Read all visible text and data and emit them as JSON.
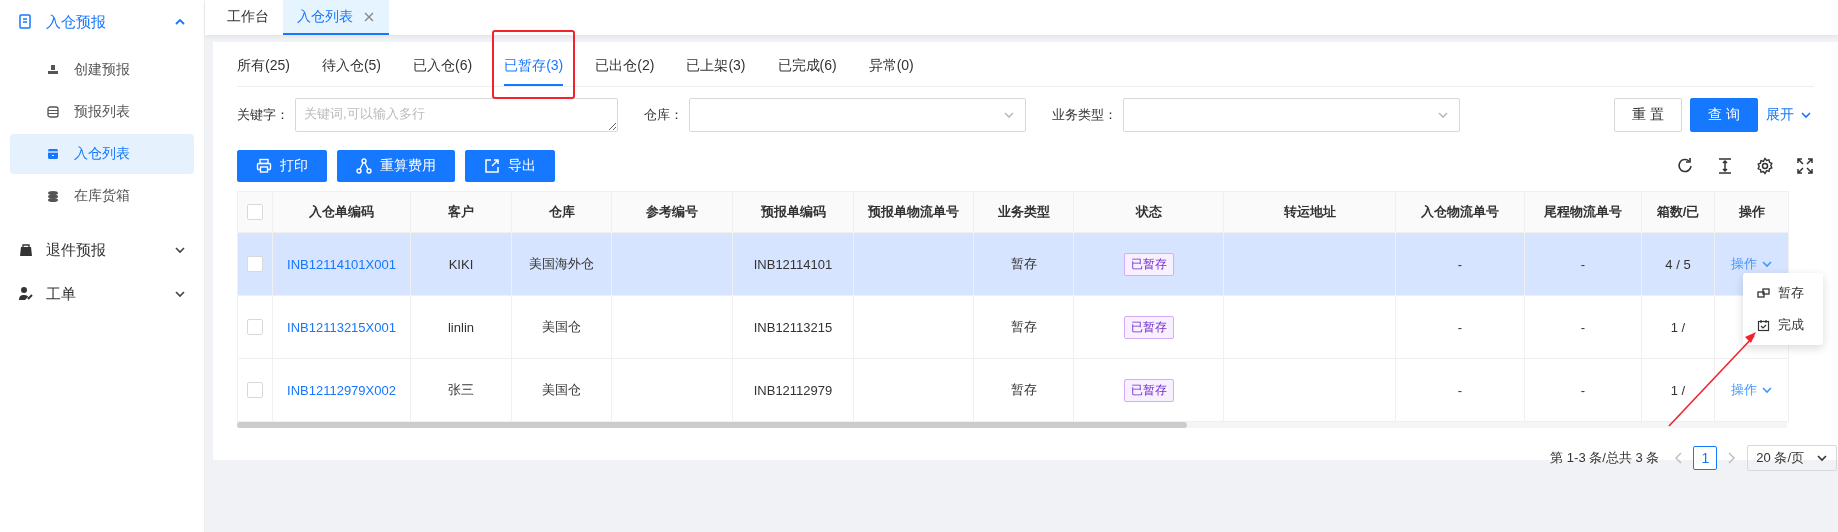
{
  "sidebar": {
    "items": [
      {
        "label": "入仓预报",
        "selected": true,
        "expanded": true,
        "children": [
          {
            "label": "创建预报",
            "selected": false
          },
          {
            "label": "预报列表",
            "selected": false
          },
          {
            "label": "入仓列表",
            "selected": true
          },
          {
            "label": "在库货箱",
            "selected": false
          }
        ]
      },
      {
        "label": "退件预报",
        "selected": false,
        "expanded": false
      },
      {
        "label": "工单",
        "selected": false,
        "expanded": false
      }
    ]
  },
  "page_tabs": [
    {
      "label": "工作台",
      "selected": false,
      "closable": false
    },
    {
      "label": "入仓列表",
      "selected": true,
      "closable": true
    }
  ],
  "status_tabs": [
    {
      "label": "所有(25)",
      "selected": false,
      "marked": false
    },
    {
      "label": "待入仓(5)",
      "selected": false,
      "marked": false
    },
    {
      "label": "已入仓(6)",
      "selected": false,
      "marked": false
    },
    {
      "label": "已暂存(3)",
      "selected": true,
      "marked": true
    },
    {
      "label": "已出仓(2)",
      "selected": false,
      "marked": false
    },
    {
      "label": "已上架(3)",
      "selected": false,
      "marked": false
    },
    {
      "label": "已完成(6)",
      "selected": false,
      "marked": false
    },
    {
      "label": "异常(0)",
      "selected": false,
      "marked": false
    }
  ],
  "filters": [
    {
      "kind": "textarea",
      "label": "关键字：",
      "placeholder": "关键词,可以输入多行"
    },
    {
      "kind": "select",
      "label": "仓库："
    },
    {
      "kind": "select",
      "label": "业务类型："
    }
  ],
  "filter_actions": {
    "reset": "重 置",
    "query": "查 询",
    "expand": "展开"
  },
  "action_buttons": [
    {
      "label": "打印"
    },
    {
      "label": "重算费用"
    },
    {
      "label": "导出"
    }
  ],
  "table": {
    "all_checked": false,
    "columns": [
      "入仓单编码",
      "客户",
      "仓库",
      "参考编号",
      "预报单编码",
      "预报单物流单号",
      "业务类型",
      "状态",
      "转运地址",
      "入仓物流单号",
      "尾程物流单号",
      "箱数/已",
      "操作"
    ],
    "rows": [
      {
        "selected": true,
        "checked": false,
        "code": "INB12114101X001",
        "customer": "KIKI",
        "warehouse": "美国海外仓",
        "forecast_code": "INB12114101",
        "business_type": "暂存",
        "status": "已暂存",
        "inbound_tracking": "-",
        "last_mile_tracking": "-",
        "boxes": "4 / 5",
        "action": "操作"
      },
      {
        "selected": false,
        "checked": false,
        "code": "INB12113215X001",
        "customer": "linlin",
        "warehouse": "美国仓",
        "forecast_code": "INB12113215",
        "business_type": "暂存",
        "status": "已暂存",
        "inbound_tracking": "-",
        "last_mile_tracking": "-",
        "boxes": "1 /"
      },
      {
        "selected": false,
        "checked": false,
        "code": "INB12112979X002",
        "customer": "张三",
        "warehouse": "美国仓",
        "forecast_code": "INB12112979",
        "business_type": "暂存",
        "status": "已暂存",
        "inbound_tracking": "-",
        "last_mile_tracking": "-",
        "boxes": "1 /",
        "action": "操作"
      }
    ],
    "action_menu": {
      "open": true,
      "items": [
        {
          "label": "暂存"
        },
        {
          "label": "完成"
        }
      ]
    }
  },
  "pagination": {
    "summary": "第 1-3 条/总共 3 条",
    "pages": [
      {
        "label": "1",
        "selected": true
      }
    ],
    "page_size": "20 条/页"
  },
  "annotation_arrow": true
}
